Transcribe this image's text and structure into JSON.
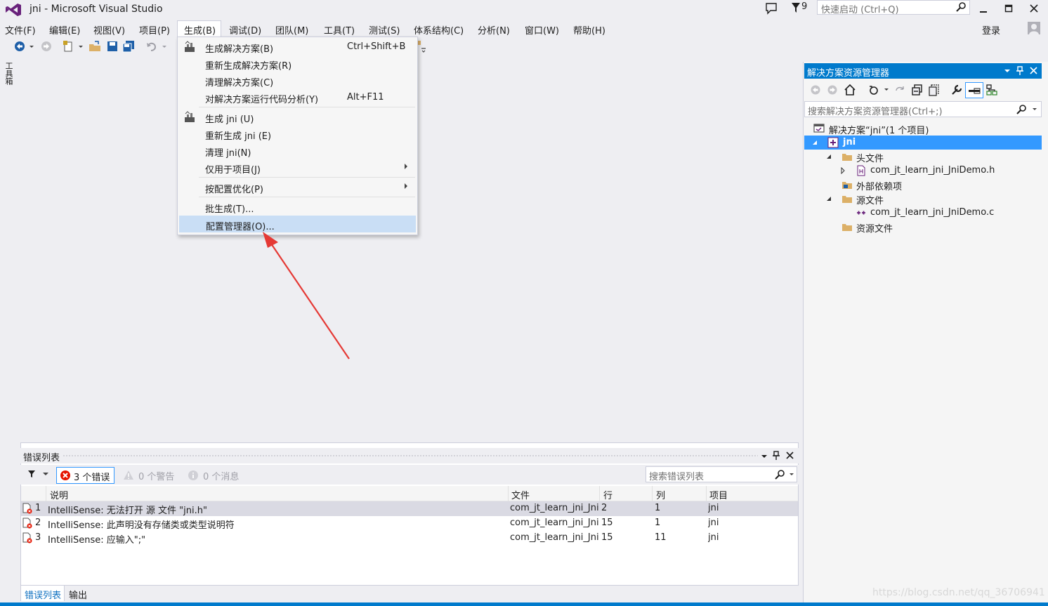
{
  "window": {
    "title": "jni - Microsoft Visual Studio",
    "notification_count": "9",
    "quick_launch_placeholder": "快速启动 (Ctrl+Q)",
    "login": "登录",
    "accent_color": "#007acc"
  },
  "menubar": {
    "items": [
      "文件(F)",
      "编辑(E)",
      "视图(V)",
      "项目(P)",
      "生成(B)",
      "调试(D)",
      "团队(M)",
      "工具(T)",
      "测试(S)",
      "体系结构(C)",
      "分析(N)",
      "窗口(W)",
      "帮助(H)"
    ],
    "active": "生成(B)"
  },
  "toolbox_label": "工具箱",
  "build_menu": {
    "items": [
      {
        "label": "生成解决方案(B)",
        "shortcut": "Ctrl+Shift+B",
        "icon": "build-icon"
      },
      {
        "label": "重新生成解决方案(R)",
        "shortcut": ""
      },
      {
        "label": "清理解决方案(C)",
        "shortcut": ""
      },
      {
        "label": "对解决方案运行代码分析(Y)",
        "shortcut": "Alt+F11"
      },
      {
        "label": "生成 jni (U)",
        "shortcut": "",
        "icon": "build-icon"
      },
      {
        "label": "重新生成 jni (E)",
        "shortcut": ""
      },
      {
        "label": "清理 jni(N)",
        "shortcut": ""
      },
      {
        "label": "仅用于项目(J)",
        "shortcut": "",
        "submenu": true
      },
      {
        "label": "按配置优化(P)",
        "shortcut": "",
        "submenu": true
      },
      {
        "label": "批生成(T)...",
        "shortcut": ""
      },
      {
        "label": "配置管理器(O)...",
        "shortcut": "",
        "highlighted": true
      }
    ]
  },
  "solution_explorer": {
    "title": "解决方案资源管理器",
    "search_placeholder": "搜索解决方案资源管理器(Ctrl+;)",
    "tree": {
      "solution": "解决方案“jni”(1 个项目)",
      "project": "jni",
      "header_folder": "头文件",
      "header_file": "com_jt_learn_jni_JniDemo.h",
      "external_deps": "外部依赖项",
      "source_folder": "源文件",
      "source_file": "com_jt_learn_jni_JniDemo.c",
      "resource_folder": "资源文件"
    }
  },
  "error_list": {
    "title": "错误列表",
    "errors_label": "3 个错误",
    "warnings_label": "0 个警告",
    "messages_label": "0 个消息",
    "search_placeholder": "搜索错误列表",
    "columns": {
      "description": "说明",
      "file": "文件",
      "line": "行",
      "column": "列",
      "project": "项目"
    },
    "rows": [
      {
        "num": "1",
        "desc": "IntelliSense:  无法打开 源 文件 \"jni.h\"",
        "file": "com_jt_learn_jni_JniI",
        "line": "2",
        "col": "1",
        "project": "jni"
      },
      {
        "num": "2",
        "desc": "IntelliSense:  此声明没有存储类或类型说明符",
        "file": "com_jt_learn_jni_JniI",
        "line": "15",
        "col": "1",
        "project": "jni"
      },
      {
        "num": "3",
        "desc": "IntelliSense:  应输入\";\"",
        "file": "com_jt_learn_jni_JniI",
        "line": "15",
        "col": "11",
        "project": "jni"
      }
    ]
  },
  "bottom_tabs": [
    "错误列表",
    "输出"
  ],
  "watermark": "https://blog.csdn.net/qq_36706941"
}
